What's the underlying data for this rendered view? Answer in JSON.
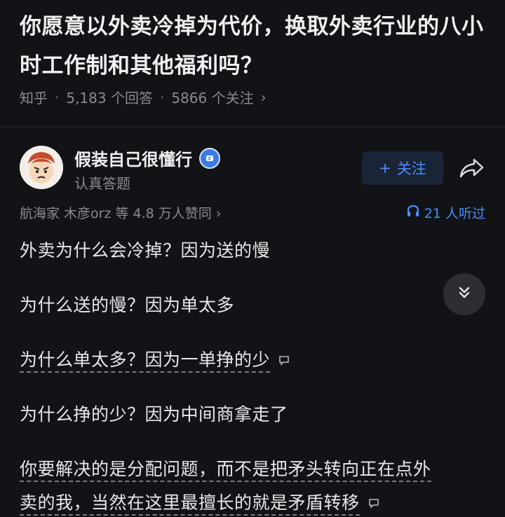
{
  "question": {
    "title": "你愿意以外卖冷掉为代价，换取外卖行业的八小时工作制和其他福利吗？",
    "source": "知乎",
    "answers": "5,183 个回答",
    "followers": "5866 个关注",
    "chevron": "›"
  },
  "answer": {
    "author_name": "假装自己很懂行",
    "author_bio": "认真答题",
    "follow_label": "关注",
    "follow_plus": "+",
    "upvoters": "航海家 木彦orz 等 4.8 万人赞同 ›",
    "listen_count": "21 人听过",
    "paragraphs": [
      "外卖为什么会冷掉？因为送的慢",
      "为什么送的慢？因为单太多",
      "为什么单太多？因为一单挣的少",
      "为什么挣的少？因为中间商拿走了",
      "你要解决的是分配问题，而不是把矛头转向正在点外",
      "卖的我，当然在这里最擅长的就是矛盾转移"
    ]
  },
  "colors": {
    "background": "#121316",
    "accent": "#4d8dfb",
    "muted": "#8a8b90"
  },
  "icons": [
    "verified-badge-icon",
    "share-icon",
    "headphone-icon",
    "comment-icon",
    "double-chevron-down-icon"
  ]
}
